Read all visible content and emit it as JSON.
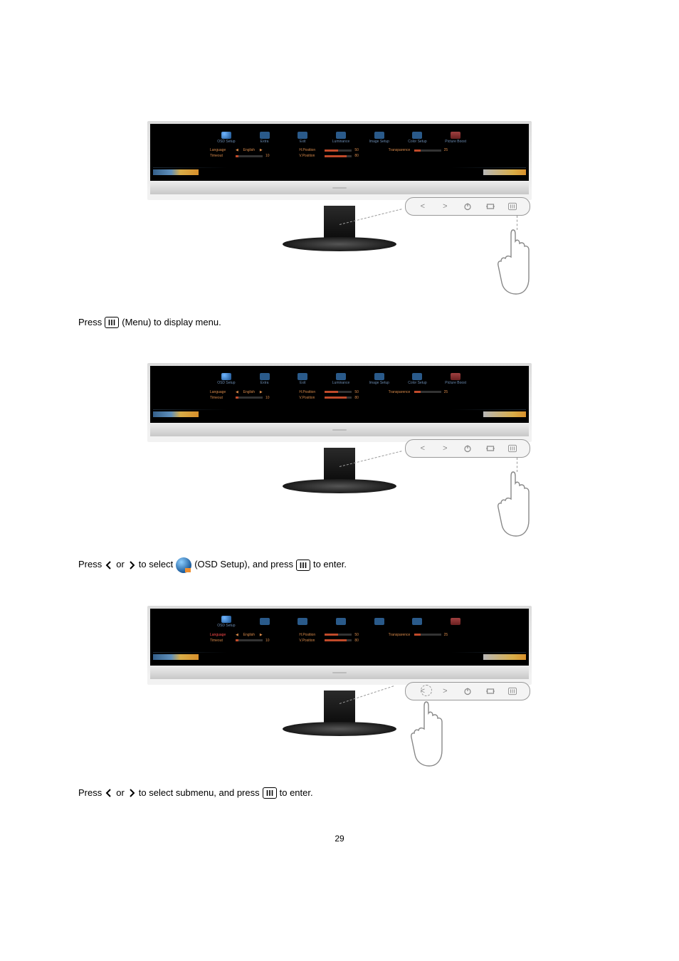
{
  "osd_tabs": [
    {
      "name": "osd-setup",
      "label": "OSD Setup"
    },
    {
      "name": "extra",
      "label": "Extra"
    },
    {
      "name": "exit",
      "label": "Exit"
    },
    {
      "name": "luminance",
      "label": "Luminance"
    },
    {
      "name": "image-setup",
      "label": "Image Setup"
    },
    {
      "name": "color-setup",
      "label": "Color Setup"
    },
    {
      "name": "picture-boost",
      "label": "Picture Boost"
    }
  ],
  "osd_rows": {
    "language": {
      "label": "Language",
      "value": "English"
    },
    "timeout": {
      "label": "Timeout",
      "value": "10"
    },
    "hpos": {
      "label": "H.Position",
      "value": "50"
    },
    "vpos": {
      "label": "V.Position",
      "value": "80"
    },
    "transparence": {
      "label": "Transparence",
      "value": "25"
    }
  },
  "instr1": {
    "a": "Press",
    "b": "(Menu) to display menu."
  },
  "instr2": {
    "a": "Press",
    "b": "or",
    "c": "to select",
    "d": "(OSD Setup), and press",
    "e": "to enter."
  },
  "instr3": {
    "a": "Press",
    "b": "or",
    "c": "to select submenu, and press",
    "d": "to enter."
  },
  "page_number": "29"
}
